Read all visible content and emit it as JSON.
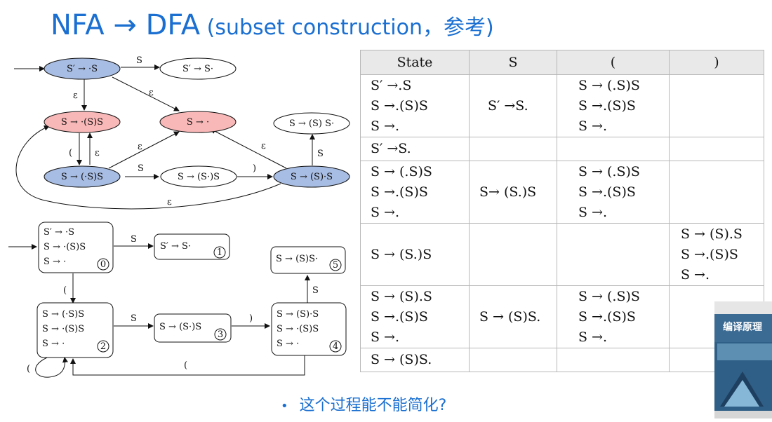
{
  "title": {
    "main": "NFA → DFA",
    "sub": " (subset construction，参考)"
  },
  "nfa": {
    "states": {
      "s_start": "S′ → ·S",
      "s_accept": "S′ → S·",
      "s_paren_open": "S → ·(S)S",
      "s_empty": "S → ·",
      "s_complete": "S → (S) S·",
      "s_inner": "S → (·S)S",
      "s_mid": "S → (S·)S",
      "s_after": "S → (S)·S"
    },
    "labels": {
      "S": "S",
      "eps": "ε",
      "lparen": "(",
      "rparen": ")"
    }
  },
  "dfa_diagram": {
    "states": [
      {
        "lines": [
          "S′ → ·S",
          "S → ·(S)S",
          "S → ·"
        ],
        "num": "0"
      },
      {
        "lines": [
          "S′ → S·"
        ],
        "num": "1"
      },
      {
        "lines": [
          "S → (·S)S",
          "S → ·(S)S",
          "S → ·"
        ],
        "num": "2"
      },
      {
        "lines": [
          "S → (S·)S"
        ],
        "num": "3"
      },
      {
        "lines": [
          "S → (S)·S",
          "S → ·(S)S",
          "S → ·"
        ],
        "num": "4"
      },
      {
        "lines": [
          "S → (S)S·"
        ],
        "num": "5"
      }
    ],
    "labels": {
      "S": "S",
      "lparen": "(",
      "rparen": ")"
    }
  },
  "table": {
    "headers": [
      "State",
      "S",
      "(",
      ")"
    ],
    "rows": [
      {
        "state": [
          "S′ →.S",
          "S →.(S)S",
          "S →."
        ],
        "s": [
          "S′ →S."
        ],
        "lp": [
          "S → (.S)S",
          "S →.(S)S",
          "S →."
        ],
        "rp": []
      },
      {
        "state": [
          "S′ →S."
        ],
        "s": [],
        "lp": [],
        "rp": []
      },
      {
        "state": [
          "S → (.S)S",
          "S →.(S)S",
          "S →."
        ],
        "s": [
          "S→ (S.)S"
        ],
        "lp": [
          "S → (.S)S",
          "S →.(S)S",
          "S →."
        ],
        "rp": []
      },
      {
        "state": [
          "S → (S.)S"
        ],
        "s": [],
        "lp": [],
        "rp": [
          "S → (S).S",
          "S →.(S)S",
          "S →."
        ]
      },
      {
        "state": [
          "S → (S).S",
          "S →.(S)S",
          "S →."
        ],
        "s": [
          "S → (S)S."
        ],
        "lp": [
          "S → (.S)S",
          "S →.(S)S",
          "S →."
        ],
        "rp": []
      },
      {
        "state": [
          "S → (S)S."
        ],
        "s": [],
        "lp": [],
        "rp": []
      }
    ]
  },
  "bullet": "这个过程能不能简化?",
  "book": {
    "title": "编译原理"
  },
  "colors": {
    "title": "#1a6fd1",
    "state_blue": "#a8bde3",
    "state_red": "#f9b8b8"
  }
}
